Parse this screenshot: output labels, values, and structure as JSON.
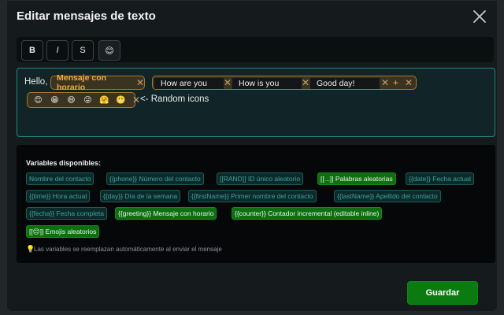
{
  "dialog": {
    "title": "Editar mensajes de texto"
  },
  "toolbar": {
    "bold_label": "B",
    "italic_label": "I",
    "strike_label": "S",
    "emoji_label": "😊"
  },
  "editor": {
    "prefix_text": "Hello,",
    "greeting_chip": "Mensaje con horario",
    "random_options": [
      "How are you",
      "How is you",
      "Good day!"
    ],
    "add_symbol": "+",
    "emojis": [
      "😊",
      "😁",
      "😄",
      "😜",
      "🤗",
      "😬"
    ],
    "suffix_text": "<- Random icons"
  },
  "variables": {
    "title": "Variables disponibles:",
    "tags": [
      {
        "label": "Nombre del contacto",
        "style": "ghost"
      },
      {
        "label": "{{phone}} Número del contacto",
        "style": "ghost"
      },
      {
        "label": "[[RAND]] ID único aleatorio",
        "style": "ghost"
      },
      {
        "label": "[[...]] Palabras aleatorias",
        "style": "solid"
      },
      {
        "label": "{{date}} Fecha actual",
        "style": "ghost"
      },
      {
        "label": "{{time}} Hora actual",
        "style": "ghost"
      },
      {
        "label": "{{day}} Día de la semana",
        "style": "ghost"
      },
      {
        "label": "{{firstName}} Primer nombre del contacto",
        "style": "ghost"
      },
      {
        "label": "{{lastName}} Apellido del contacto",
        "style": "ghost"
      },
      {
        "label": "{{fecha}} Fecha completa",
        "style": "ghost"
      },
      {
        "label": "{{greeting}} Mensaje con horario",
        "style": "solid"
      },
      {
        "label": "{{counter}} Contador incremental (editable inline)",
        "style": "solid"
      },
      {
        "label": "[[😊]] Emojis aleatorios",
        "style": "solid"
      }
    ],
    "hint": "Las variables se reemplazan automáticamente al enviar el mensaje"
  },
  "footer": {
    "save_label": "Guardar"
  },
  "colors": {
    "accent_teal": "#1f8a80",
    "chip_orange": "#f4a93a",
    "save_green": "#0b7a10"
  }
}
